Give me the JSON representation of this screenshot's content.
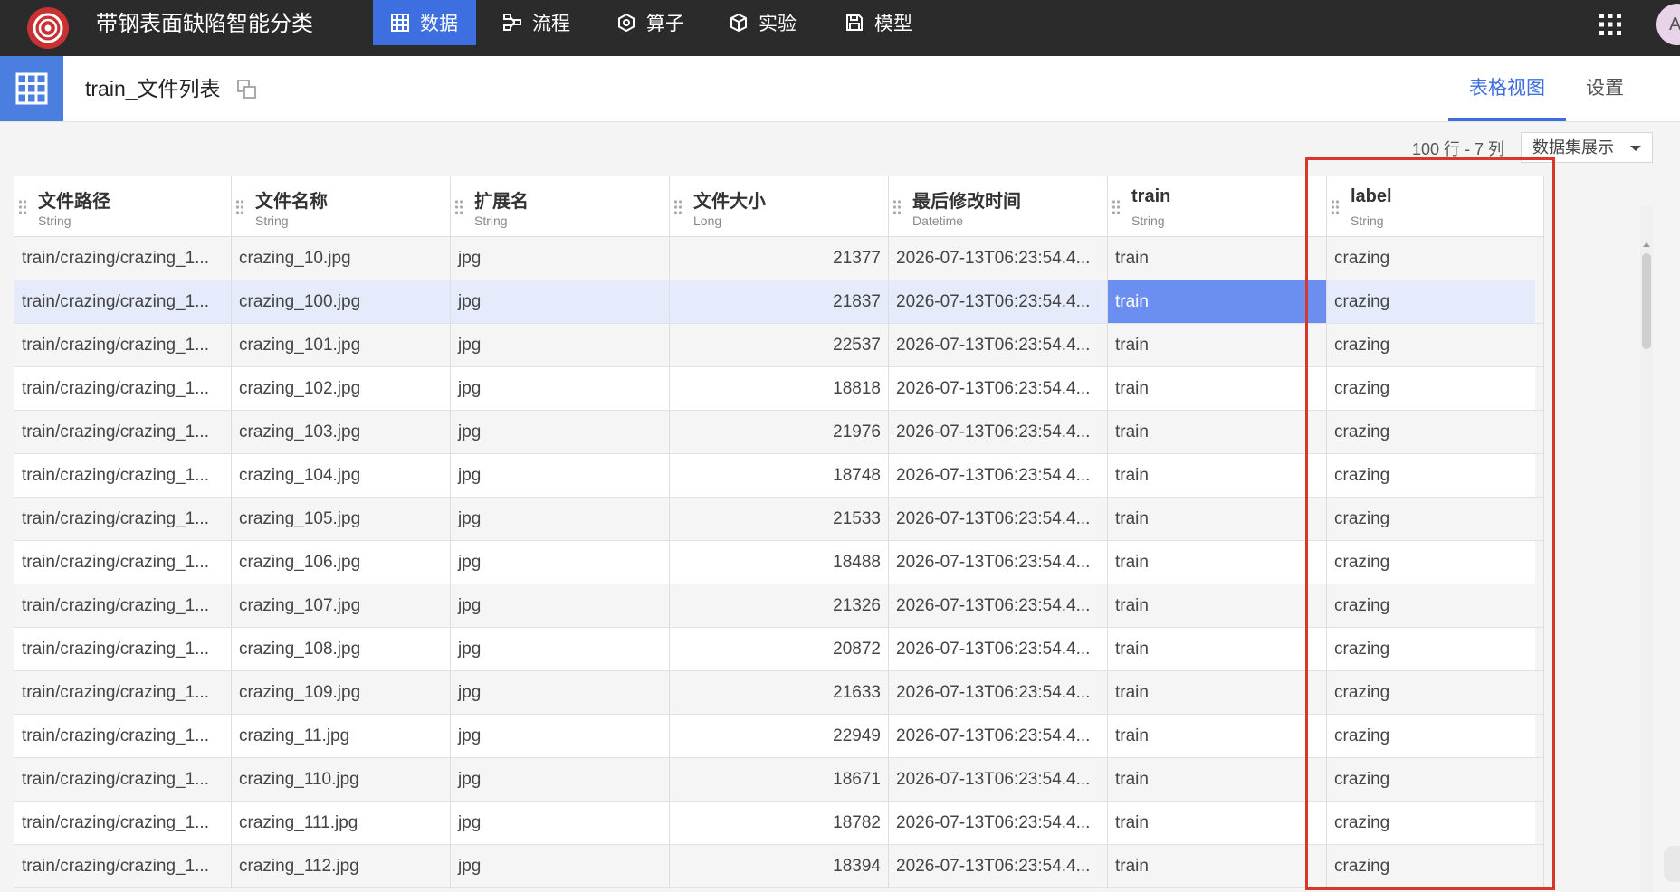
{
  "app": {
    "title": "带钢表面缺陷智能分类"
  },
  "nav": [
    {
      "label": "数据",
      "icon": "table-icon"
    },
    {
      "label": "流程",
      "icon": "flow-icon"
    },
    {
      "label": "算子",
      "icon": "operator-icon"
    },
    {
      "label": "实验",
      "icon": "cube-icon"
    },
    {
      "label": "模型",
      "icon": "save-icon"
    }
  ],
  "user": {
    "avatar": "A"
  },
  "page": {
    "title": "train_文件列表"
  },
  "tabs": {
    "table_view": "表格视图",
    "settings": "设置"
  },
  "table_info": {
    "counts": "100 行 - 7 列",
    "view_select": "数据集展示"
  },
  "columns": [
    {
      "name": "文件路径",
      "type": "String"
    },
    {
      "name": "文件名称",
      "type": "String"
    },
    {
      "name": "扩展名",
      "type": "String"
    },
    {
      "name": "文件大小",
      "type": "Long"
    },
    {
      "name": "最后修改时间",
      "type": "Datetime"
    },
    {
      "name": "train",
      "type": "String"
    },
    {
      "name": "label",
      "type": "String"
    }
  ],
  "rows": [
    {
      "path": "train/crazing/crazing_1...",
      "name": "crazing_10.jpg",
      "ext": "jpg",
      "size": "21377",
      "mtime": "2026-07-13T06:23:54.4...",
      "train": "train",
      "label": "crazing"
    },
    {
      "path": "train/crazing/crazing_1...",
      "name": "crazing_100.jpg",
      "ext": "jpg",
      "size": "21837",
      "mtime": "2026-07-13T06:23:54.4...",
      "train": "train",
      "label": "crazing"
    },
    {
      "path": "train/crazing/crazing_1...",
      "name": "crazing_101.jpg",
      "ext": "jpg",
      "size": "22537",
      "mtime": "2026-07-13T06:23:54.4...",
      "train": "train",
      "label": "crazing"
    },
    {
      "path": "train/crazing/crazing_1...",
      "name": "crazing_102.jpg",
      "ext": "jpg",
      "size": "18818",
      "mtime": "2026-07-13T06:23:54.4...",
      "train": "train",
      "label": "crazing"
    },
    {
      "path": "train/crazing/crazing_1...",
      "name": "crazing_103.jpg",
      "ext": "jpg",
      "size": "21976",
      "mtime": "2026-07-13T06:23:54.4...",
      "train": "train",
      "label": "crazing"
    },
    {
      "path": "train/crazing/crazing_1...",
      "name": "crazing_104.jpg",
      "ext": "jpg",
      "size": "18748",
      "mtime": "2026-07-13T06:23:54.4...",
      "train": "train",
      "label": "crazing"
    },
    {
      "path": "train/crazing/crazing_1...",
      "name": "crazing_105.jpg",
      "ext": "jpg",
      "size": "21533",
      "mtime": "2026-07-13T06:23:54.4...",
      "train": "train",
      "label": "crazing"
    },
    {
      "path": "train/crazing/crazing_1...",
      "name": "crazing_106.jpg",
      "ext": "jpg",
      "size": "18488",
      "mtime": "2026-07-13T06:23:54.4...",
      "train": "train",
      "label": "crazing"
    },
    {
      "path": "train/crazing/crazing_1...",
      "name": "crazing_107.jpg",
      "ext": "jpg",
      "size": "21326",
      "mtime": "2026-07-13T06:23:54.4...",
      "train": "train",
      "label": "crazing"
    },
    {
      "path": "train/crazing/crazing_1...",
      "name": "crazing_108.jpg",
      "ext": "jpg",
      "size": "20872",
      "mtime": "2026-07-13T06:23:54.4...",
      "train": "train",
      "label": "crazing"
    },
    {
      "path": "train/crazing/crazing_1...",
      "name": "crazing_109.jpg",
      "ext": "jpg",
      "size": "21633",
      "mtime": "2026-07-13T06:23:54.4...",
      "train": "train",
      "label": "crazing"
    },
    {
      "path": "train/crazing/crazing_1...",
      "name": "crazing_11.jpg",
      "ext": "jpg",
      "size": "22949",
      "mtime": "2026-07-13T06:23:54.4...",
      "train": "train",
      "label": "crazing"
    },
    {
      "path": "train/crazing/crazing_1...",
      "name": "crazing_110.jpg",
      "ext": "jpg",
      "size": "18671",
      "mtime": "2026-07-13T06:23:54.4...",
      "train": "train",
      "label": "crazing"
    },
    {
      "path": "train/crazing/crazing_1...",
      "name": "crazing_111.jpg",
      "ext": "jpg",
      "size": "18782",
      "mtime": "2026-07-13T06:23:54.4...",
      "train": "train",
      "label": "crazing"
    },
    {
      "path": "train/crazing/crazing_1...",
      "name": "crazing_112.jpg",
      "ext": "jpg",
      "size": "18394",
      "mtime": "2026-07-13T06:23:54.4...",
      "train": "train",
      "label": "crazing"
    }
  ],
  "selection": {
    "row": 1,
    "column": "train"
  },
  "colors": {
    "accent": "#3d6fe0",
    "highlight_box": "#d6392c",
    "selected_cell": "#6b8ff0",
    "selected_row": "#e6ebfb"
  }
}
